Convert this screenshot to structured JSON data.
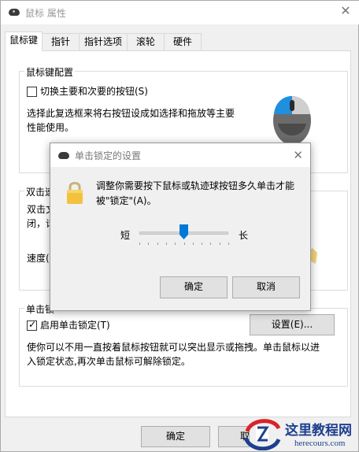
{
  "window": {
    "title": "鼠标 属性",
    "tabs": [
      "鼠标键",
      "指针",
      "指针选项",
      "滚轮",
      "硬件"
    ],
    "active_tab": "鼠标键"
  },
  "button_config": {
    "group_label": "鼠标键配置",
    "checkbox_label": "切换主要和次要的按钮(S)",
    "checked": false,
    "description": [
      "选择此复选框来将右按钮设成如选择和拖放等主要",
      "性能使用。"
    ]
  },
  "double_click": {
    "group_label_partial": "双击速",
    "desc_partial": [
      "双击文",
      "闭，请"
    ],
    "speed_label_partial": "速度(D"
  },
  "click_lock": {
    "group_label_partial": "单击锁",
    "checkbox_label": "启用单击锁定(T)",
    "checked": true,
    "settings_button": "设置(E)...",
    "description": [
      "使你可以不用一直按着鼠标按钮就可以突出显示或拖拽。单击鼠标以进",
      "入锁定状态,再次单击鼠标可解除锁定。"
    ]
  },
  "footer": {
    "ok_button": "确定",
    "cancel_partial": "取"
  },
  "dialog": {
    "title": "单击锁定的设置",
    "message": [
      "调整你需要按下鼠标或轨迹球按钮多久单击才能",
      "被\"锁定\"(A)。"
    ],
    "slider_min_label": "短",
    "slider_max_label": "长",
    "slider_value": 0.5,
    "ok_button": "确定",
    "cancel_button": "取消"
  },
  "watermark": {
    "line1": "这里教程网",
    "line2": "herecours.com"
  },
  "icons": {
    "title_icon": "mouse-icon",
    "close": "close-icon",
    "lock": "lock-icon",
    "logo": "watermark-logo-icon"
  },
  "colors": {
    "accent": "#0078d7",
    "watermark_red": "#d9232a",
    "watermark_blue": "#1e3f8f"
  }
}
